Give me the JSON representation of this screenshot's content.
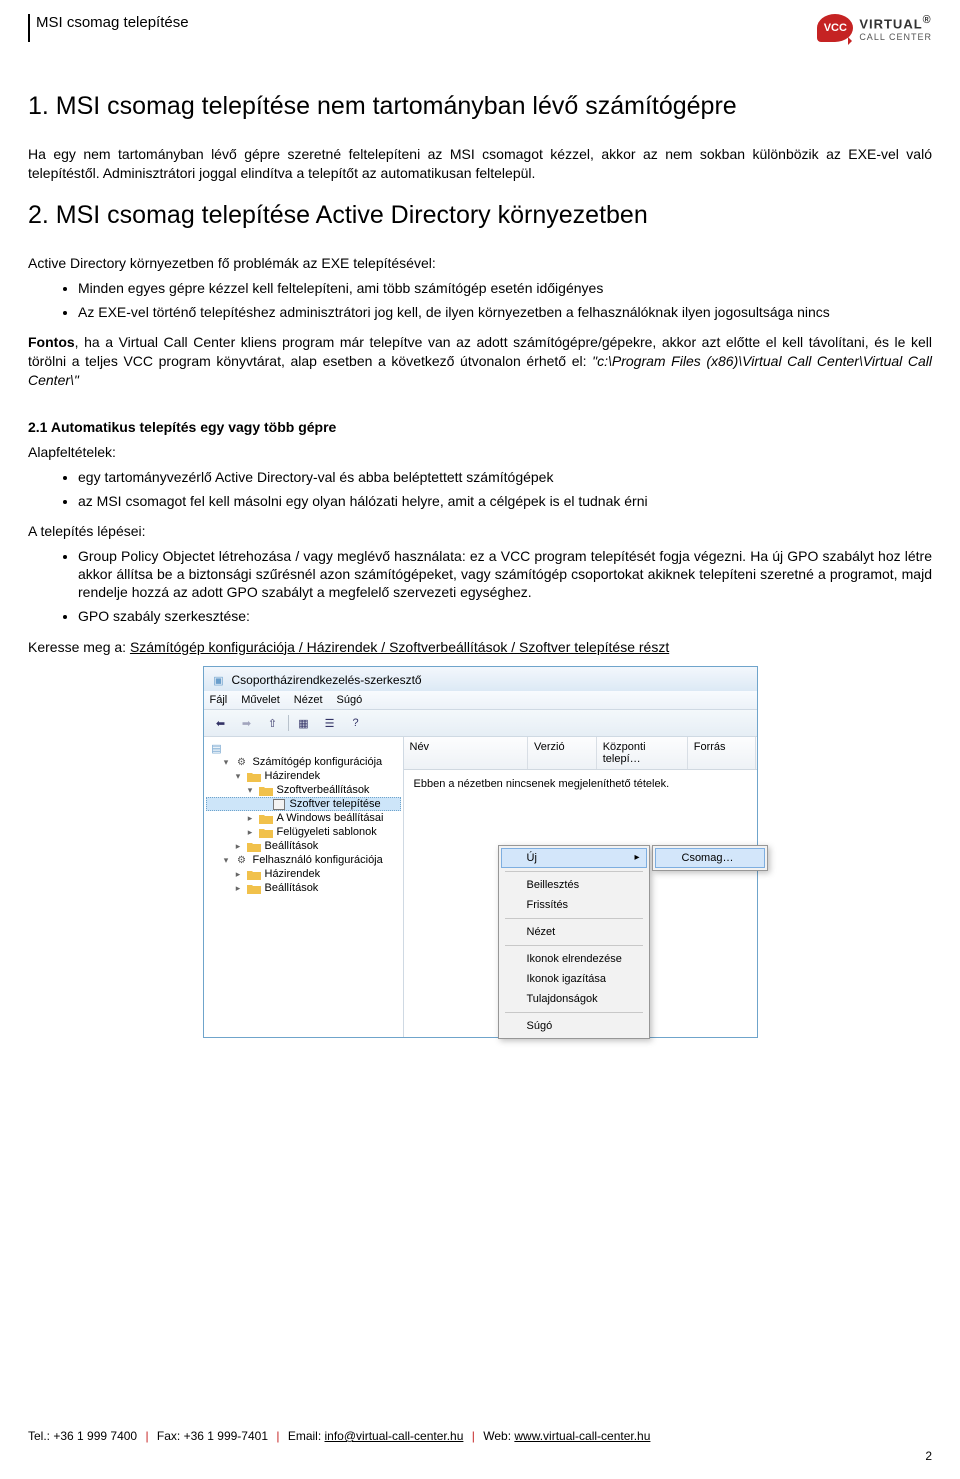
{
  "header": {
    "title": "MSI csomag telepítése"
  },
  "logo": {
    "bubble": "VCC",
    "line1": "VIRTUAL",
    "line2": "CALL CENTER",
    "reg": "®"
  },
  "section1": {
    "heading": "1. MSI csomag telepítése nem tartományban lévő számítógépre",
    "para": "Ha egy nem tartományban lévő gépre szeretné feltelepíteni az MSI csomagot kézzel, akkor az nem sokban különbözik az EXE-vel való telepítéstől. Adminisztrátori joggal elindítva a telepítőt az automatikusan feltelepül."
  },
  "section2": {
    "heading": "2. MSI csomag telepítése Active Directory környezetben",
    "intro": "Active Directory környezetben fő problémák az EXE telepítésével:",
    "bullets": [
      "Minden egyes gépre kézzel kell feltelepíteni, ami több számítógép esetén időigényes",
      "Az EXE-vel történő telepítéshez adminisztrátori jog kell, de ilyen környezetben a felhasználóknak ilyen jogosultsága nincs"
    ],
    "important_label": "Fontos",
    "important": ", ha a Virtual Call Center kliens program már telepítve van az adott számítógépre/gépekre, akkor azt előtte el kell távolítani, és le kell törölni a teljes VCC program könyvtárat, alap esetben a következő útvonalon érhető el: ",
    "important_path": "\"c:\\Program Files (x86)\\Virtual Call Center\\Virtual Call Center\\\""
  },
  "section21": {
    "heading": "2.1 Automatikus telepítés egy vagy több gépre",
    "pre_label": "Alapfeltételek:",
    "pre_items": [
      "egy tartományvezérlő Active Directory-val és abba beléptettett számítógépek",
      "az MSI csomagot fel kell másolni egy olyan hálózati helyre, amit a célgépek is el tudnak érni"
    ],
    "steps_label": "A telepítés lépései:",
    "step1": "Group Policy Objectet létrehozása / vagy meglévő használata: ez a VCC program telepítését fogja végezni. Ha új GPO szabályt hoz létre akkor állítsa be a biztonsági szűrésnél azon számítógépeket, vagy számítógép csoportokat akiknek telepíteni szeretné a programot, majd rendelje hozzá az adott GPO szabályt a megfelelő szervezeti egységhez.",
    "step2": "GPO szabály szerkesztése:",
    "find_prefix": "Keresse meg a: ",
    "find_path": "Számítógép konfigurációja / Házirendek / Szoftverbeállítások / Szoftver telepítése részt"
  },
  "appwindow": {
    "title": "Csoportházirendkezelés-szerkesztő",
    "menu": [
      "Fájl",
      "Művelet",
      "Nézet",
      "Súgó"
    ],
    "tree": {
      "items": [
        {
          "lv": 1,
          "toggle": "▿",
          "icon": "gear",
          "label": "Számítógép konfigurációja"
        },
        {
          "lv": 2,
          "toggle": "▿",
          "icon": "folder",
          "label": "Házirendek"
        },
        {
          "lv": 3,
          "toggle": "▿",
          "icon": "folder",
          "label": "Szoftverbeállítások"
        },
        {
          "lv": 4,
          "toggle": "",
          "icon": "box",
          "label": "Szoftver telepítése",
          "selected": true
        },
        {
          "lv": 3,
          "toggle": "▹",
          "icon": "folder",
          "label": "A Windows beállításai"
        },
        {
          "lv": 3,
          "toggle": "▹",
          "icon": "folder",
          "label": "Felügyeleti sablonok"
        },
        {
          "lv": 2,
          "toggle": "▹",
          "icon": "folder",
          "label": "Beállítások"
        },
        {
          "lv": 1,
          "toggle": "▿",
          "icon": "gear",
          "label": "Felhasználó konfigurációja"
        },
        {
          "lv": 2,
          "toggle": "▹",
          "icon": "folder",
          "label": "Házirendek"
        },
        {
          "lv": 2,
          "toggle": "▹",
          "icon": "folder",
          "label": "Beállítások"
        }
      ]
    },
    "columns": [
      "Név",
      "Verzió",
      "Központi telepí…",
      "Forrás"
    ],
    "empty_msg": "Ebben a nézetben nincsenek megjeleníthető tételek.",
    "context_menu": {
      "items": [
        {
          "label": "Új",
          "hover": true
        },
        {
          "sep": true
        },
        {
          "label": "Beillesztés"
        },
        {
          "label": "Frissítés"
        },
        {
          "sep": true
        },
        {
          "label": "Nézet"
        },
        {
          "sep": true
        },
        {
          "label": "Ikonok elrendezése"
        },
        {
          "label": "Ikonok igazítása"
        },
        {
          "label": "Tulajdonságok"
        },
        {
          "sep": true
        },
        {
          "label": "Súgó"
        }
      ],
      "submenu": {
        "label": "Csomag…"
      }
    }
  },
  "footer": {
    "tel_label": "Tel.: ",
    "tel": "+36 1 999 7400",
    "fax_label": "Fax: ",
    "fax": "+36 1 999-7401",
    "email_label": "Email: ",
    "email": "info@virtual-call-center.hu",
    "web_label": "Web: ",
    "web": "www.virtual-call-center.hu",
    "page": "2"
  }
}
